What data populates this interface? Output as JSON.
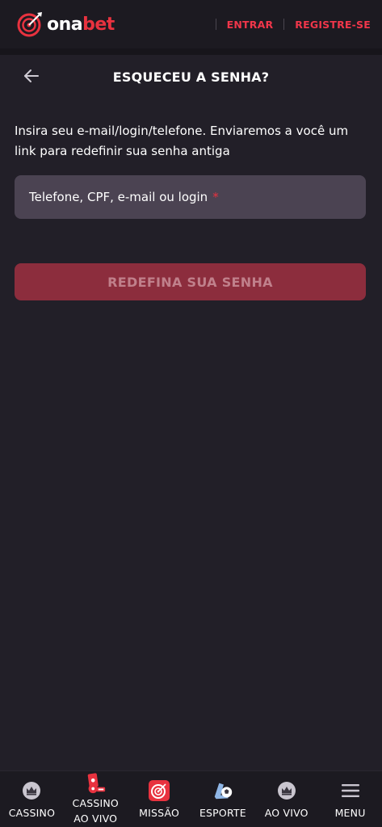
{
  "header": {
    "logo_prefix": "ona",
    "logo_accent": "bet",
    "login_label": "ENTRAR",
    "register_label": "REGISTRE-SE"
  },
  "page": {
    "title": "ESQUECEU A SENHA?",
    "instructions": "Insira seu e-mail/login/telefone. Enviaremos a você um link para redefinir sua senha antiga",
    "input_placeholder": "Telefone, CPF, e-mail ou login",
    "required_mark": "*",
    "submit_label": "REDEFINA SUA SENHA"
  },
  "bottom_nav": {
    "items": [
      {
        "label": "CASSINO",
        "icon": "crown-icon"
      },
      {
        "label": "CASSINO\nAO VIVO",
        "line1": "CASSINO",
        "line2": "AO VIVO",
        "icon": "live-casino-icon"
      },
      {
        "label": "MISSÃO",
        "icon": "target-icon"
      },
      {
        "label": "ESPORTE",
        "icon": "sport-ball-icon"
      },
      {
        "label": "AO VIVO",
        "icon": "crown-icon"
      },
      {
        "label": "MENU",
        "icon": "hamburger-menu-icon"
      }
    ]
  },
  "colors": {
    "background": "#221f28",
    "header": "#1c1a21",
    "accent": "#e8323f",
    "link": "#f0364a",
    "input_bg": "#4b4352",
    "button_bg": "#8c2d3d"
  }
}
